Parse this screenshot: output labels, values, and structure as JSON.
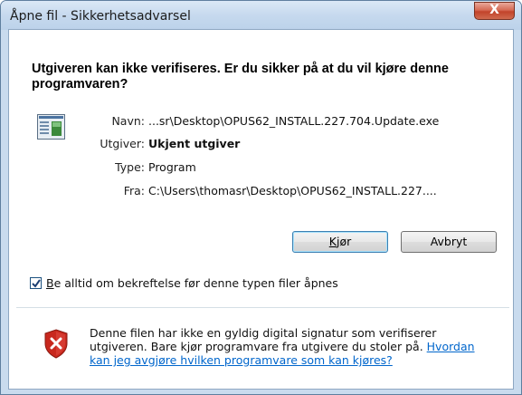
{
  "window": {
    "title": "Åpne fil - Sikkerhetsadvarsel",
    "close_glyph": "X"
  },
  "dialog": {
    "headline": "Utgiveren kan ikke verifiseres. Er du sikker på at du vil kjøre denne programvaren?",
    "fields": [
      {
        "label": "Navn:",
        "value": "...sr\\Desktop\\OPUS62_INSTALL.227.704.Update.exe"
      },
      {
        "label": "Utgiver:",
        "value": "Ukjent utgiver"
      },
      {
        "label": "Type:",
        "value": "Program"
      },
      {
        "label": "Fra:",
        "value": "C:\\Users\\thomasr\\Desktop\\OPUS62_INSTALL.227...."
      }
    ],
    "buttons": {
      "run_mnemonic": "K",
      "run_rest": "jør",
      "cancel": "Avbryt"
    },
    "checkbox": {
      "checked": true,
      "mnemonic": "B",
      "label_rest": "e alltid om bekreftelse før denne typen filer åpnes"
    },
    "warning": {
      "text": "Denne filen har ikke en gyldig digital signatur som verifiserer utgiveren. Bare kjør programvare fra utgivere du stoler på. ",
      "link": "Hvordan kan jeg avgjøre hvilken programvare som kan kjøres?"
    }
  },
  "icons": {
    "app": "application-icon",
    "shield": "shield-error-icon",
    "check": "checkmark-icon"
  },
  "colors": {
    "link": "#0066cc",
    "close_button": "#c2432a",
    "shield_red": "#c8281e"
  }
}
